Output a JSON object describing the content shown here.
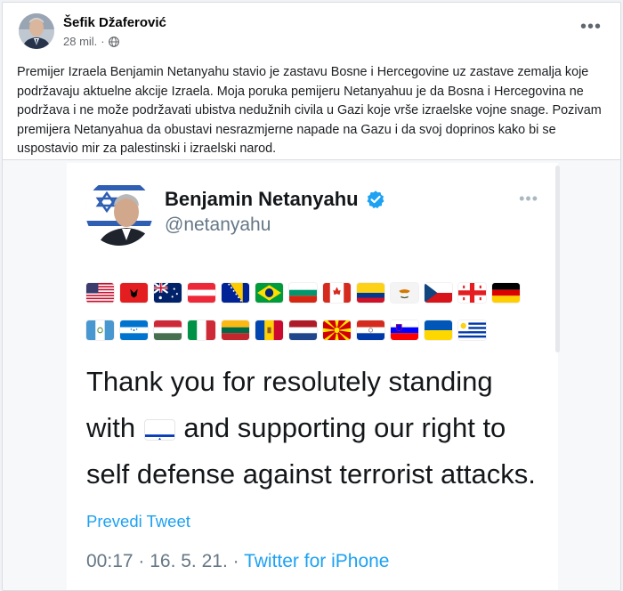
{
  "post": {
    "author": "Šefik Džaferović",
    "time": "28 mil.",
    "audience_icon": "globe-icon",
    "more_icon": "ellipsis-icon",
    "more": "•••",
    "text": "Premijer Izraela Benjamin Netanyahu stavio je zastavu Bosne i Hercegovine uz zastave zemalja koje podržavaju aktuelne akcije Izraela. Moja poruka pemijeru Netanyahuu je da Bosna i Hercegovina ne podržava i ne može podržavati ubistva nedužnih civila u Gazi koje vrše izraelske vojne snage. Pozivam premijera Netanyahua da obustavi nesrazmjerne napade na Gazu i da svoj doprinos kako bi se uspostavio mir za palestinski i izraelski narod."
  },
  "tweet": {
    "name": "Benjamin Netanyahu",
    "verified_icon": "verified-badge-icon",
    "handle": "@netanyahu",
    "more": "•••",
    "flags_row1": [
      "us",
      "al",
      "au",
      "at",
      "ba",
      "br",
      "bg",
      "ca",
      "co",
      "cy",
      "cz",
      "ge",
      "de"
    ],
    "flags_row2": [
      "gt",
      "hn",
      "hu",
      "it",
      "lt",
      "md",
      "nl",
      "mk",
      "py",
      "si",
      "ua",
      "uy"
    ],
    "text_part1": "Thank you for resolutely standing with",
    "inline_flag": "il",
    "text_part2": "and supporting our right to self defense against terrorist attacks.",
    "translate": "Prevedi Tweet",
    "timestamp": "00:17 · 16. 5. 21. · ",
    "source": "Twitter for iPhone"
  },
  "colors": {
    "link_blue": "#1da1f2",
    "facebook_text": "#1c1e21",
    "muted": "#657786"
  }
}
